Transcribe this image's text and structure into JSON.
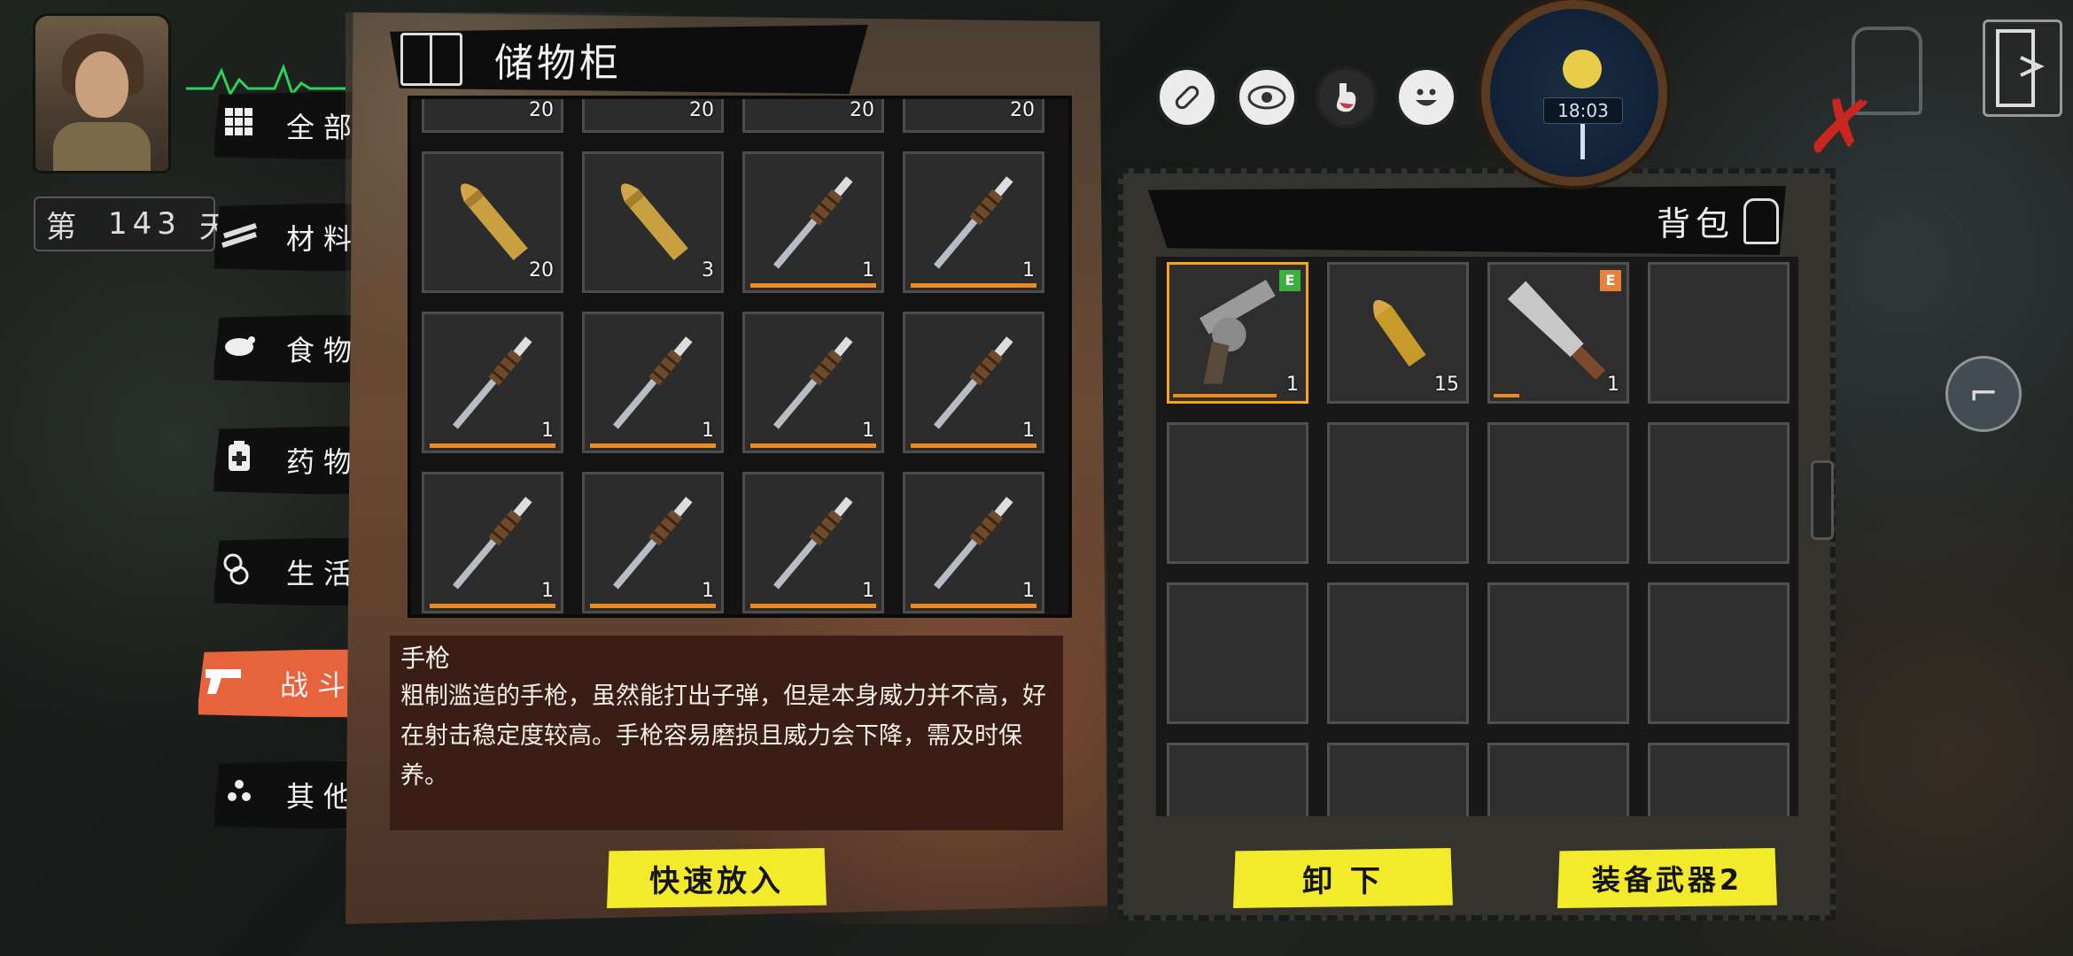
{
  "hud": {
    "day_prefix": "第",
    "day_number": "143",
    "day_suffix": "天",
    "clock_time": "18:03"
  },
  "status_icons": [
    "pill-icon",
    "eye-icon",
    "stomach-icon",
    "smile-icon"
  ],
  "categories": [
    {
      "label": "全部",
      "icon": "grid-icon"
    },
    {
      "label": "材料",
      "icon": "planks-icon"
    },
    {
      "label": "食物",
      "icon": "chicken-icon"
    },
    {
      "label": "药物",
      "icon": "medicine-icon"
    },
    {
      "label": "生活",
      "icon": "handcuff-icon"
    },
    {
      "label": "战斗",
      "icon": "pistol-icon",
      "active": true
    },
    {
      "label": "其他",
      "icon": "dots-icon"
    }
  ],
  "storage": {
    "title": "储物柜",
    "slots": [
      {
        "item": "bullet",
        "qty": "20"
      },
      {
        "item": "bullet",
        "qty": "20"
      },
      {
        "item": "bullet",
        "qty": "20"
      },
      {
        "item": "bullet",
        "qty": "20"
      },
      {
        "item": "rifle-bullet",
        "qty": "20"
      },
      {
        "item": "rifle-bullet",
        "qty": "3"
      },
      {
        "item": "spear",
        "qty": "1",
        "durability": 1.0
      },
      {
        "item": "spear",
        "qty": "1",
        "durability": 1.0
      },
      {
        "item": "spear",
        "qty": "1",
        "durability": 1.0
      },
      {
        "item": "spear",
        "qty": "1",
        "durability": 1.0
      },
      {
        "item": "spear",
        "qty": "1",
        "durability": 1.0
      },
      {
        "item": "spear",
        "qty": "1",
        "durability": 1.0
      },
      {
        "item": "spear",
        "qty": "1",
        "durability": 1.0
      },
      {
        "item": "spear",
        "qty": "1",
        "durability": 1.0
      },
      {
        "item": "spear",
        "qty": "1",
        "durability": 1.0
      },
      {
        "item": "spear",
        "qty": "1",
        "durability": 1.0
      }
    ]
  },
  "description": {
    "name": "手枪",
    "text": "粗制滥造的手枪，虽然能打出子弹，但是本身威力并不高，好在射击稳定度较高。手枪容易磨损且威力会下降，需及时保养。"
  },
  "buttons": {
    "quick_put": "快速放入",
    "unload": "卸 下",
    "equip_weapon": "装备武器2"
  },
  "backpack": {
    "title": "背包",
    "slots": [
      {
        "item": "revolver",
        "qty": "1",
        "tag": "E",
        "tag_color": "#3cb03c",
        "durability": 0.8,
        "selected": true
      },
      {
        "item": "bullet",
        "qty": "15"
      },
      {
        "item": "machete",
        "qty": "1",
        "tag": "E",
        "tag_color": "#e8823a",
        "durability": 0.2
      },
      {
        "item": "empty"
      },
      {
        "item": "empty"
      },
      {
        "item": "empty"
      },
      {
        "item": "empty"
      },
      {
        "item": "empty"
      },
      {
        "item": "empty"
      },
      {
        "item": "empty"
      },
      {
        "item": "empty"
      },
      {
        "item": "empty"
      },
      {
        "item": "empty"
      },
      {
        "item": "empty"
      },
      {
        "item": "empty"
      },
      {
        "item": "empty"
      }
    ]
  }
}
